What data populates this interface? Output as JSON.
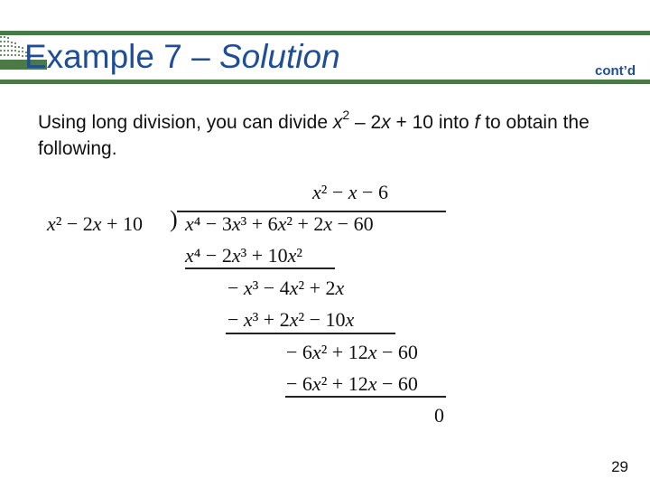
{
  "slide": {
    "title_main": "Example 7 – ",
    "title_italic": "Solution",
    "continued_label": "cont’d",
    "page_number": "29",
    "colors": {
      "bar": "#4a7a45",
      "title": "#1f4e96"
    }
  },
  "body": {
    "text_1": "Using long division, you can divide ",
    "expr_x": "x",
    "expr_exp": "2",
    "text_2": " – 2",
    "expr_x2": "x",
    "text_3": " + 10 into ",
    "expr_f": "f",
    "text_4": " to obtain the following."
  },
  "long_division": {
    "quotient": "x² − x − 6",
    "divisor": "x² − 2x + 10",
    "dividend": "x⁴ − 3x³ + 6x² + 2x − 60",
    "steps": [
      "x⁴ − 2x³ + 10x²",
      "−x³ − 4x² + 2x",
      "−x³ + 2x² − 10x",
      "−6x² + 12x − 60",
      "−6x² + 12x − 60",
      "0"
    ]
  }
}
